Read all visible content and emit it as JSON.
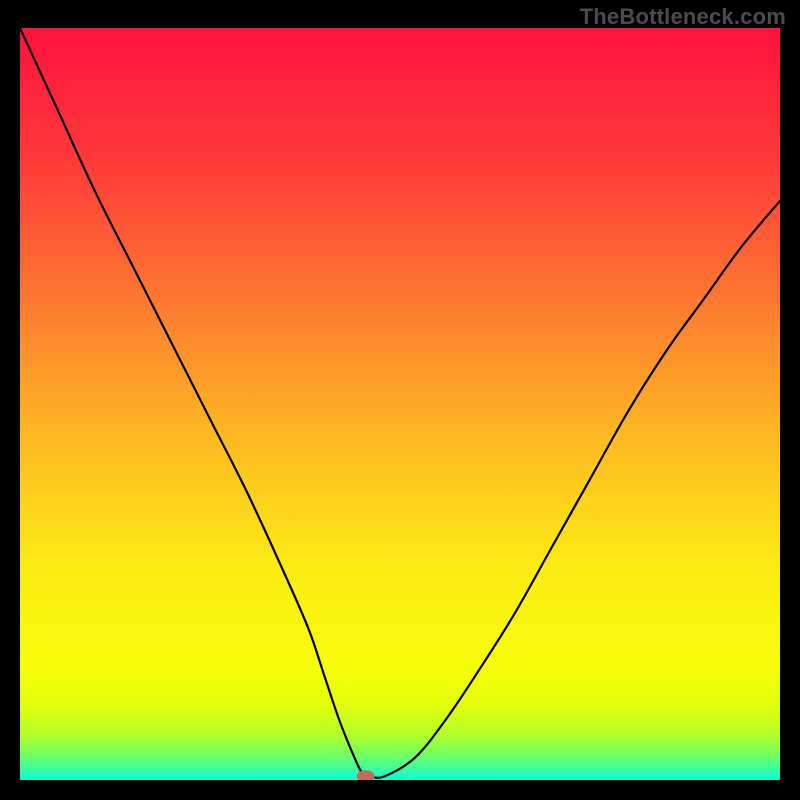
{
  "watermark": "TheBottleneck.com",
  "chart_data": {
    "type": "line",
    "title": "",
    "xlabel": "",
    "ylabel": "",
    "xlim": [
      0,
      100
    ],
    "ylim": [
      0,
      100
    ],
    "grid": false,
    "legend": false,
    "annotations": [],
    "series": [
      {
        "name": "bottleneck-curve",
        "color": "#000000",
        "x": [
          0,
          5,
          10,
          15,
          20,
          25,
          30,
          35,
          38,
          40,
          42,
          44,
          45,
          46,
          48,
          52,
          56,
          60,
          65,
          70,
          75,
          80,
          85,
          90,
          95,
          100
        ],
        "y": [
          100,
          89,
          78,
          68,
          58,
          48,
          38,
          27,
          20,
          14,
          8,
          3,
          1,
          0.5,
          0.5,
          3,
          8,
          14,
          22,
          31,
          40,
          49,
          57,
          64,
          71,
          77
        ]
      }
    ],
    "marker": {
      "x": 45.5,
      "y": 0.5,
      "color": "#c66a5e",
      "rx": 9,
      "ry": 6
    },
    "background_gradient": {
      "stops": [
        {
          "offset": 0.0,
          "color": "#fe123e"
        },
        {
          "offset": 0.18,
          "color": "#fe3b39"
        },
        {
          "offset": 0.38,
          "color": "#fd7f2f"
        },
        {
          "offset": 0.55,
          "color": "#fdbb22"
        },
        {
          "offset": 0.72,
          "color": "#fbec13"
        },
        {
          "offset": 0.85,
          "color": "#f6fd0a"
        },
        {
          "offset": 0.9,
          "color": "#e3fe0b"
        },
        {
          "offset": 0.94,
          "color": "#b3fe2a"
        },
        {
          "offset": 0.97,
          "color": "#6afe6d"
        },
        {
          "offset": 1.0,
          "color": "#0bfed7"
        }
      ]
    }
  }
}
